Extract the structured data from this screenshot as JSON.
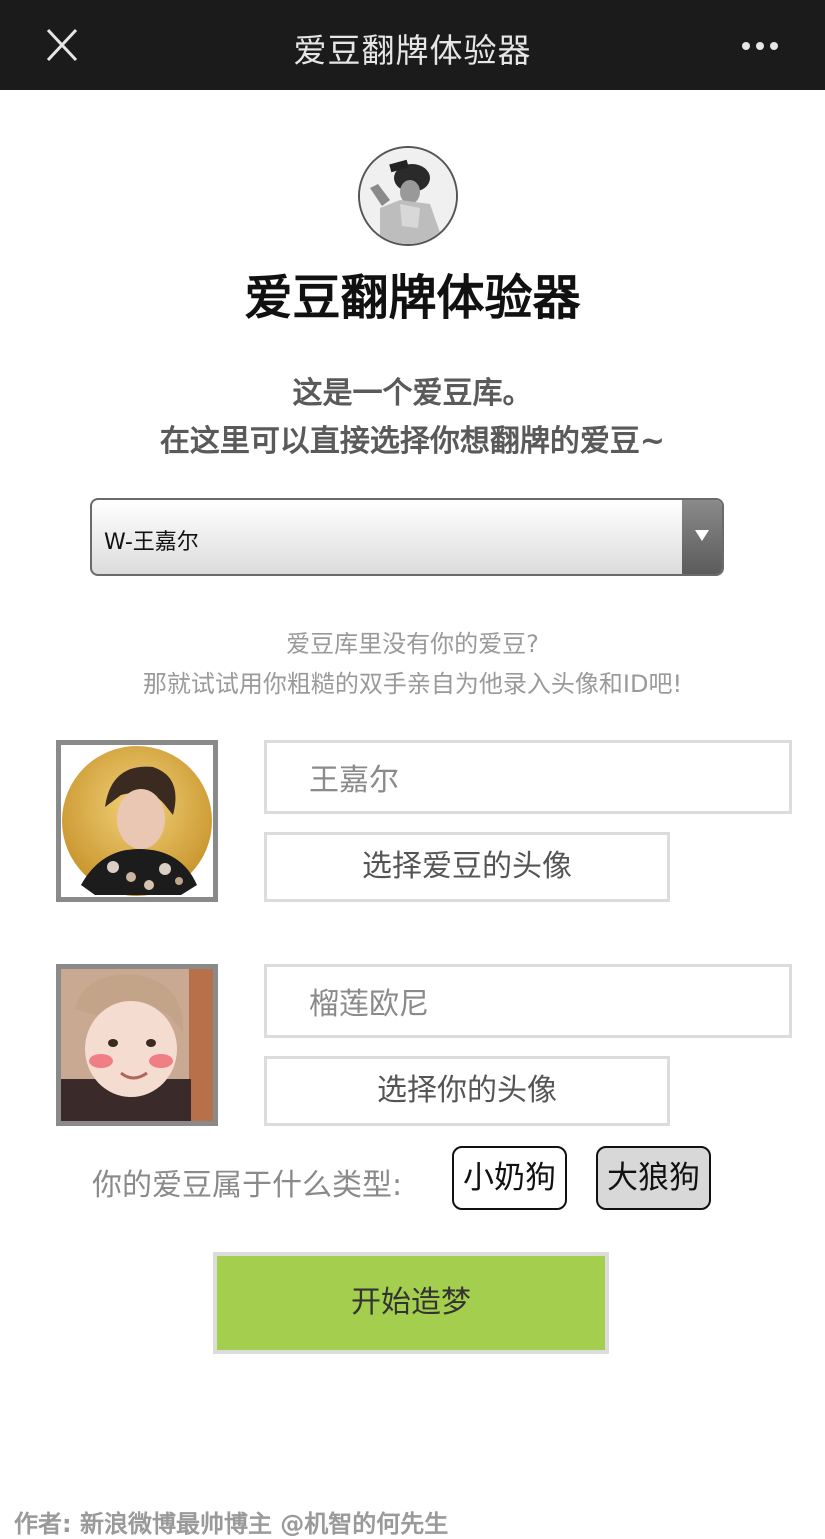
{
  "topbar": {
    "title": "爱豆翻牌体验器"
  },
  "header": {
    "title": "爱豆翻牌体验器",
    "desc_line1": "这是一个爱豆库。",
    "desc_line2": "在这里可以直接选择你想翻牌的爱豆~"
  },
  "idol_select": {
    "selected": "W-王嘉尔"
  },
  "hint": {
    "line1": "爱豆库里没有你的爱豆?",
    "line2": "那就试试用你粗糙的双手亲自为他录入头像和ID吧!"
  },
  "idol": {
    "name_value": "王嘉尔",
    "choose_avatar_label": "选择爱豆的头像"
  },
  "you": {
    "name_value": "榴莲欧尼",
    "choose_avatar_label": "选择你的头像"
  },
  "type_select": {
    "label": "你的爱豆属于什么类型:",
    "options": [
      "小奶狗",
      "大狼狗"
    ],
    "selected": "大狼狗"
  },
  "start_button": {
    "label": "开始造梦"
  },
  "footer": {
    "text": "作者: 新浪微博最帅博主 @机智的何先生"
  },
  "icons": {
    "close": "close-icon",
    "more": "more-dots-icon"
  },
  "colors": {
    "topbar": "#1b1b1b",
    "start_button": "#a4cf4e",
    "frame": "#8a8a8a"
  }
}
